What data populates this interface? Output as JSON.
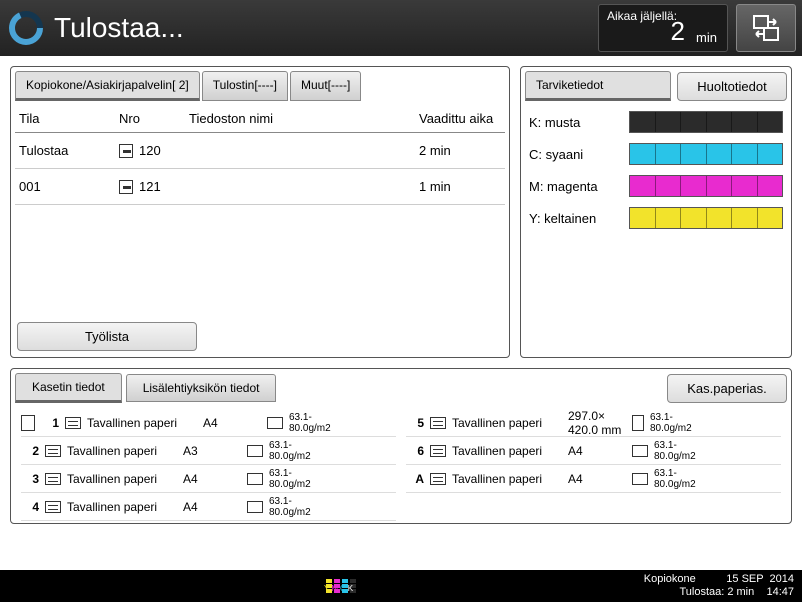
{
  "header": {
    "title": "Tulostaa...",
    "time_label": "Aikaa jäljellä:",
    "time_value": "2",
    "time_unit": "min"
  },
  "jobs": {
    "tabs": [
      {
        "label": "Kopiokone/Asiakirjapalvelin[     2]"
      },
      {
        "label": "Tulostin[----]"
      },
      {
        "label": "Muut[----]"
      }
    ],
    "columns": {
      "tila": "Tila",
      "nro": "Nro",
      "fname": "Tiedoston nimi",
      "time": "Vaadittu aika"
    },
    "rows": [
      {
        "tila": "Tulostaa",
        "nro": "120",
        "fname": "",
        "time": "2 min",
        "strong": false
      },
      {
        "tila": "001",
        "nro": "121",
        "fname": "",
        "time": "1 min",
        "strong": true
      }
    ],
    "joblist_btn": "Työlista"
  },
  "supplies": {
    "tab": "Tarviketiedot",
    "maint_btn": "Huoltotiedot",
    "items": [
      {
        "label": "K: musta",
        "color": "#2b2b2b"
      },
      {
        "label": "C: syaani",
        "color": "#29c4e8"
      },
      {
        "label": "M: magenta",
        "color": "#e82bcf"
      },
      {
        "label": "Y: keltainen",
        "color": "#f2e32b"
      }
    ]
  },
  "trays": {
    "tab1": "Kasetin tiedot",
    "tab2": "Lisälehtiyksikön tiedot",
    "btn": "Kas.paperias.",
    "items": [
      {
        "id": "1",
        "name": "Tavallinen paperi",
        "size": "A4",
        "orient": "L",
        "wt": "63.1-\n80.0g/m2",
        "outline": true
      },
      {
        "id": "5",
        "name": "Tavallinen paperi",
        "size": "297.0×\n420.0 mm",
        "orient": "P",
        "wt": "63.1-\n80.0g/m2"
      },
      {
        "id": "2",
        "name": "Tavallinen paperi",
        "size": "A3",
        "orient": "L",
        "wt": "63.1-\n80.0g/m2"
      },
      {
        "id": "6",
        "name": "Tavallinen paperi",
        "size": "A4",
        "orient": "L",
        "wt": "63.1-\n80.0g/m2"
      },
      {
        "id": "3",
        "name": "Tavallinen paperi",
        "size": "A4",
        "orient": "L",
        "wt": "63.1-\n80.0g/m2"
      },
      {
        "id": "A",
        "name": "Tavallinen paperi",
        "size": "A4",
        "orient": "L",
        "wt": "63.1-\n80.0g/m2"
      },
      {
        "id": "4",
        "name": "Tavallinen paperi",
        "size": "A4",
        "orient": "L",
        "wt": "63.1-\n80.0g/m2"
      }
    ]
  },
  "footer": {
    "line1": "Kopiokone          15 SEP  2014",
    "line2": "Tulostaa: 2 min    14:47",
    "ymck": "YMCK",
    "colors": [
      "#f2e32b",
      "#e82bcf",
      "#29c4e8",
      "#2b2b2b"
    ]
  }
}
